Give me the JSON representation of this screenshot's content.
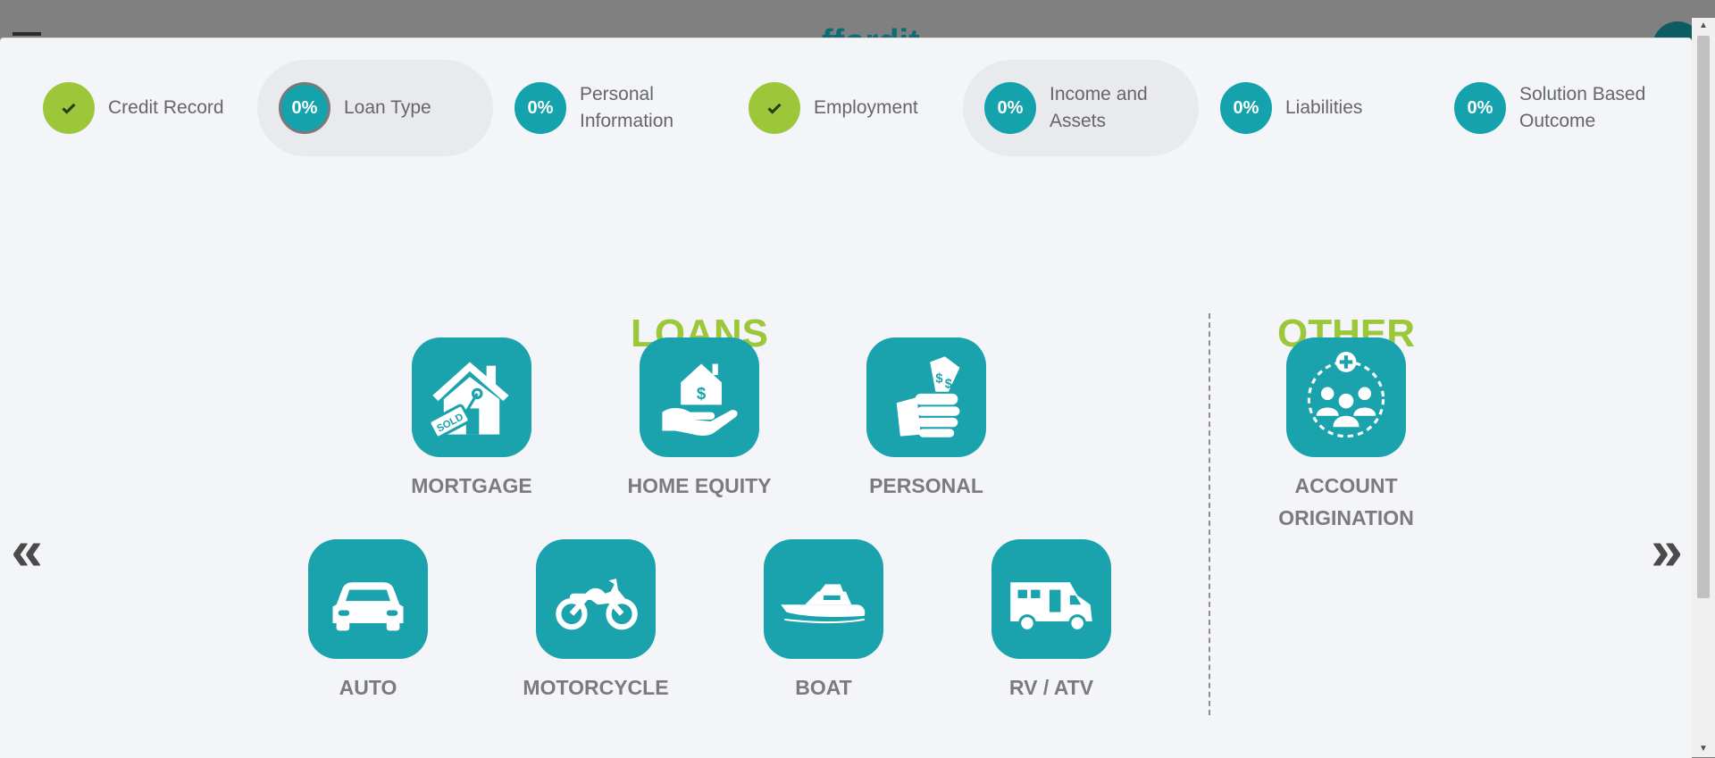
{
  "background": {
    "logo_fragment": "ffordit"
  },
  "steps": [
    {
      "label": "Credit Record",
      "status": "complete",
      "progress": ""
    },
    {
      "label": "Loan Type",
      "status": "current",
      "progress": "0%"
    },
    {
      "label": "Personal\nInformation",
      "status": "incomplete",
      "progress": "0%"
    },
    {
      "label": "Employment",
      "status": "complete",
      "progress": ""
    },
    {
      "label": "Income and\nAssets",
      "status": "active",
      "progress": "0%"
    },
    {
      "label": "Liabilities",
      "status": "incomplete",
      "progress": "0%"
    },
    {
      "label": "Solution Based\nOutcome",
      "status": "incomplete",
      "progress": "0%"
    }
  ],
  "sections": {
    "loans_title": "LOANS",
    "other_title": "OTHER"
  },
  "loans": [
    {
      "label": "MORTGAGE",
      "icon": "house-sold-icon"
    },
    {
      "label": "HOME EQUITY",
      "icon": "hand-house-icon"
    },
    {
      "label": "PERSONAL",
      "icon": "hand-money-icon"
    },
    {
      "label": "AUTO",
      "icon": "car-icon"
    },
    {
      "label": "MOTORCYCLE",
      "icon": "motorcycle-icon"
    },
    {
      "label": "BOAT",
      "icon": "boat-icon"
    },
    {
      "label": "RV / ATV",
      "icon": "rv-icon"
    }
  ],
  "other": [
    {
      "label": "ACCOUNT\nORIGINATION",
      "icon": "people-group-add-icon"
    }
  ],
  "navigation": {
    "prev": "«",
    "next": "»"
  },
  "scrollbar": {
    "up": "▲",
    "down": "▼"
  },
  "colors": {
    "accent_green": "#9dc73b",
    "accent_teal": "#1aa3ad",
    "label_gray": "#7b7b7b"
  }
}
